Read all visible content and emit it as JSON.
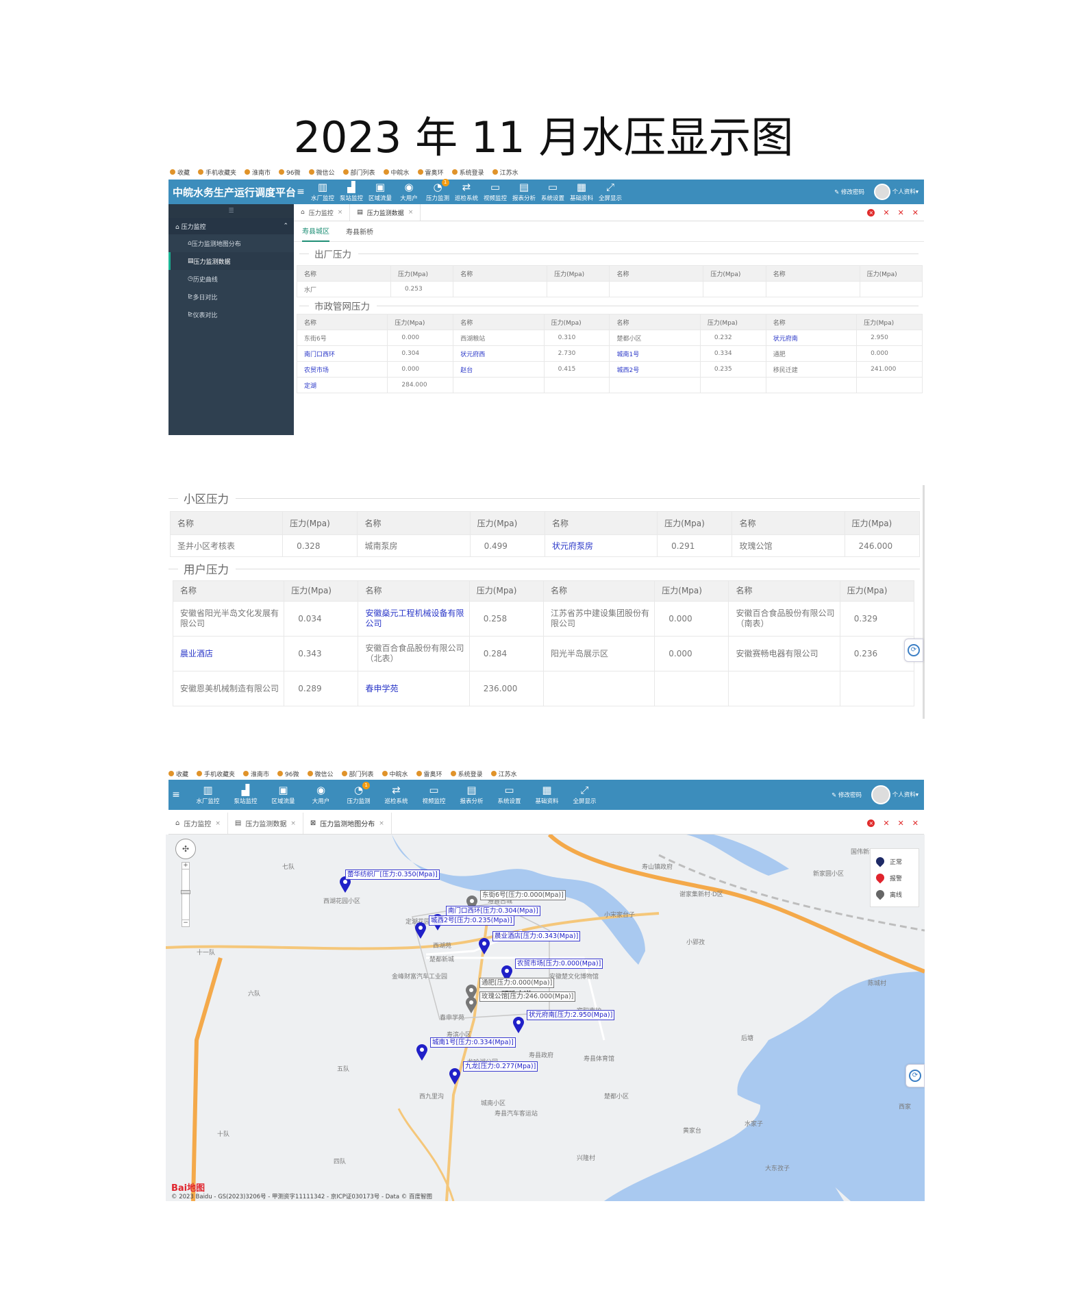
{
  "page_title": "2023 年 11 月水压显示图",
  "bookmarks": [
    "收藏",
    "手机收藏夹",
    "淮南市",
    "96微",
    "微信公",
    "部门列表",
    "中皖水",
    "雷奥环",
    "系统登录",
    "江苏水"
  ],
  "top": {
    "brand": "中皖水务生产运行调度平台",
    "menu_toggle": "≡",
    "nav": [
      {
        "label": "水厂监控",
        "icon": "factory-icon"
      },
      {
        "label": "泵站监控",
        "icon": "pump-icon"
      },
      {
        "label": "区域流量",
        "icon": "area-flow-icon"
      },
      {
        "label": "大用户",
        "icon": "user-icon"
      },
      {
        "label": "压力监测",
        "icon": "gauge-icon",
        "badge": "1"
      },
      {
        "label": "巡检系统",
        "icon": "patrol-icon"
      },
      {
        "label": "视频监控",
        "icon": "video-icon"
      },
      {
        "label": "报表分析",
        "icon": "report-icon"
      },
      {
        "label": "系统设置",
        "icon": "monitor-icon"
      },
      {
        "label": "基础资料",
        "icon": "data-icon"
      },
      {
        "label": "全屏显示",
        "icon": "fullscreen-icon"
      }
    ],
    "change_password": "修改密码",
    "profile": "个人资料"
  },
  "sidebar": {
    "group": "压力监控",
    "items": [
      "压力监测地图分布",
      "压力监测数据",
      "历史曲线",
      "多日对比",
      "仪表对比"
    ],
    "active": 1
  },
  "tabs1": [
    {
      "label": "压力监控"
    },
    {
      "label": "压力监测数据",
      "active": true
    }
  ],
  "tabs2": [
    {
      "label": "压力监控"
    },
    {
      "label": "压力监测数据"
    },
    {
      "label": "压力监测地图分布",
      "active": true
    }
  ],
  "subtabs": [
    "寿县城区",
    "寿县新桥"
  ],
  "col_name": "名称",
  "col_pressure": "压力(Mpa)",
  "sections": {
    "factory": "出厂压力",
    "municipal": "市政管网压力",
    "community": "小区压力",
    "user": "用户压力"
  },
  "factory_rows": [
    [
      {
        "n": "水厂",
        "v": "0.253"
      },
      {
        "n": "",
        "v": ""
      },
      {
        "n": "",
        "v": ""
      },
      {
        "n": "",
        "v": ""
      }
    ]
  ],
  "municipal_rows": [
    [
      {
        "n": "东街6号",
        "v": "0.000"
      },
      {
        "n": "西湖粮站",
        "v": "0.310"
      },
      {
        "n": "楚都小区",
        "v": "0.232"
      },
      {
        "n": "状元府南",
        "v": "2.950",
        "link": true
      }
    ],
    [
      {
        "n": "南门口西环",
        "v": "0.304",
        "link": true
      },
      {
        "n": "状元府西",
        "v": "2.730",
        "link": true
      },
      {
        "n": "城南1号",
        "v": "0.334",
        "link": true
      },
      {
        "n": "通肥",
        "v": "0.000"
      }
    ],
    [
      {
        "n": "农贸市场",
        "v": "0.000",
        "link": true
      },
      {
        "n": "赵台",
        "v": "0.415",
        "link": true
      },
      {
        "n": "城西2号",
        "v": "0.235",
        "link": true
      },
      {
        "n": "移民迁建",
        "v": "241.000"
      }
    ],
    [
      {
        "n": "定湖",
        "v": "284.000",
        "link": true
      },
      {
        "n": "",
        "v": ""
      },
      {
        "n": "",
        "v": ""
      },
      {
        "n": "",
        "v": ""
      }
    ]
  ],
  "community_rows": [
    [
      {
        "n": "圣井小区考核表",
        "v": "0.328"
      },
      {
        "n": "城南泵房",
        "v": "0.499"
      },
      {
        "n": "状元府泵房",
        "v": "0.291",
        "link": true
      },
      {
        "n": "玫瑰公馆",
        "v": "246.000"
      }
    ]
  ],
  "user_rows": [
    [
      {
        "n": "安徽省阳光半岛文化发展有限公司",
        "v": "0.034"
      },
      {
        "n": "安徽燊元工程机械设备有限公司",
        "v": "0.258",
        "link": true
      },
      {
        "n": "江苏省苏中建设集团股份有限公司",
        "v": "0.000"
      },
      {
        "n": "安徽百合食品股份有限公司（南表）",
        "v": "0.329"
      }
    ],
    [
      {
        "n": "晨业酒店",
        "v": "0.343",
        "link": true
      },
      {
        "n": "安徽百合食品股份有限公司（北表）",
        "v": "0.284"
      },
      {
        "n": "阳光半岛展示区",
        "v": "0.000"
      },
      {
        "n": "安徽赛畅电器有限公司",
        "v": "0.236"
      }
    ],
    [
      {
        "n": "安徽恩美机械制造有限公司",
        "v": "0.289"
      },
      {
        "n": "春申学苑",
        "v": "236.000",
        "link": true
      },
      {
        "n": "",
        "v": ""
      },
      {
        "n": "",
        "v": ""
      }
    ]
  ],
  "map": {
    "legend": [
      "正常",
      "报警",
      "离线"
    ],
    "labels": [
      "蕾华纺织厂[压力:0.350(Mpa)]",
      "东街6号[压力:0.000(Mpa)]",
      "南门口西环[压力:0.304(Mpa)]",
      "城西2号[压力:0.235(Mpa)]",
      "晨业酒店[压力:0.343(Mpa)]",
      "农贸市场[压力:0.000(Mpa)]",
      "通肥[压力:0.000(Mpa)]",
      "玫瑰公馆[压力:246.000(Mpa)]",
      "状元府南[压力:2.950(Mpa)]",
      "城南1号[压力:0.334(Mpa)]",
      "九龙[压力:0.277(Mpa)]"
    ],
    "places": [
      "七队",
      "西湖花园小区",
      "寿县古城",
      "定湖花园",
      "西湖苑",
      "楚都新城",
      "金峰财富汽车工业园",
      "十一队",
      "六队",
      "明珠大道",
      "安徽楚文化博物馆",
      "宾阳南护",
      "春申学苑",
      "寿滨小区",
      "龙吟湖公园",
      "寿县政府",
      "寿县体育馆",
      "五队",
      "西九里沟",
      "城南小区",
      "楚都小区",
      "寿县汽车客运站",
      "十队",
      "四队",
      "兴隆村",
      "黄家台",
      "水家子",
      "大东孜子",
      "后塘",
      "新家圆小区",
      "国伟新城",
      "寿山镇政府",
      "谢家集新村·D区",
      "小宋家台子",
      "小郢孜",
      "西家",
      "陈城村"
    ],
    "copyright": "© 2023 Baidu - GS(2023)3206号 - 甲测资字11111342 - 京ICP证030173号 - Data © 百度智图",
    "baidu": "Bai地图"
  },
  "colors": {
    "topbar": "#3c8dbc",
    "sidebar": "#2f4050",
    "link": "#2a37c8",
    "active_green": "#1f8f76"
  }
}
